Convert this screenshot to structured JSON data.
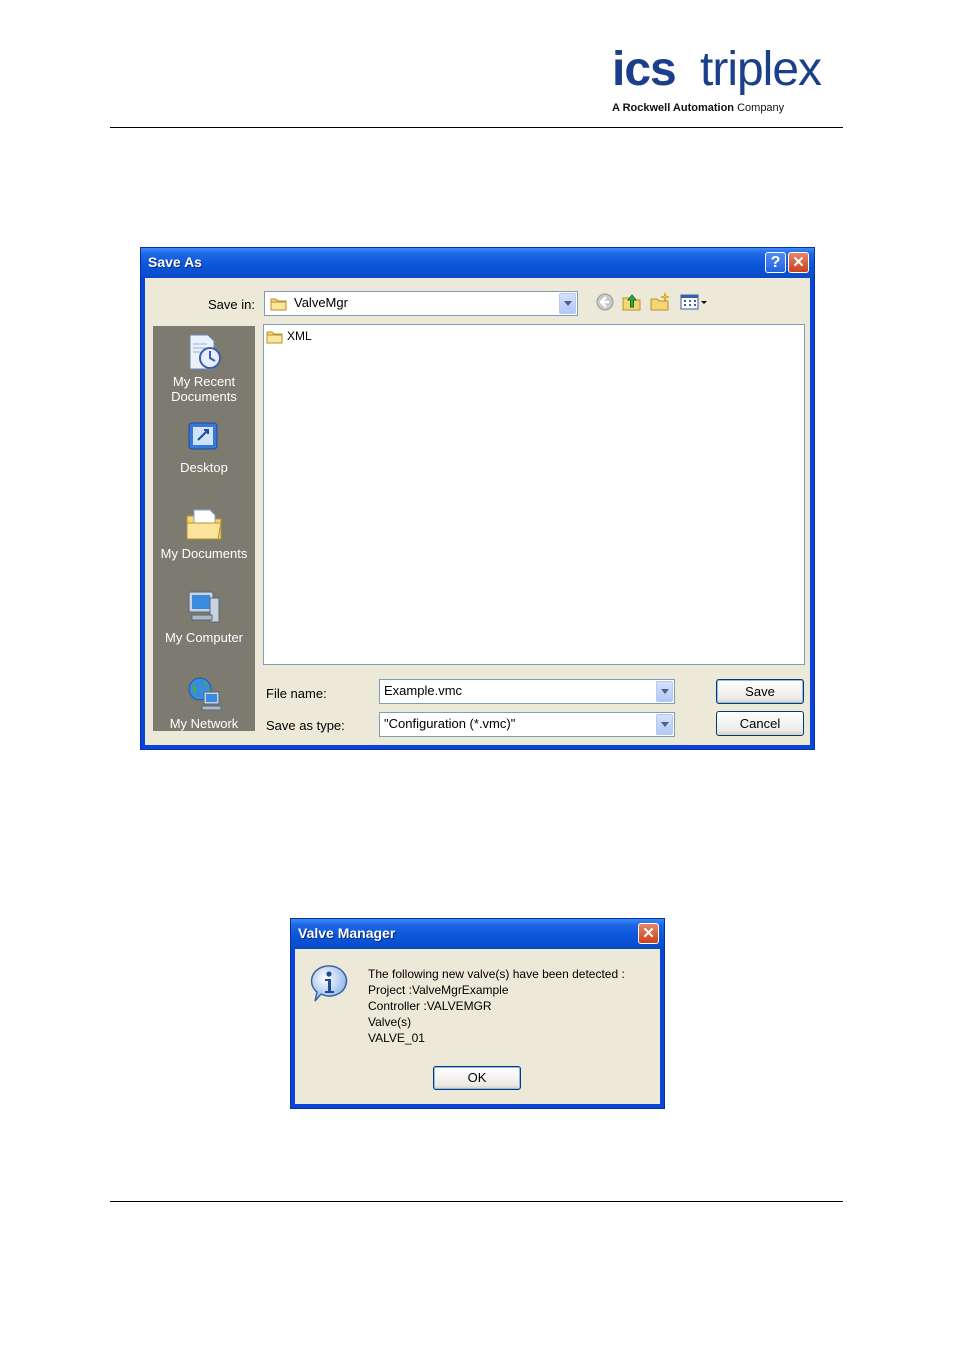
{
  "header": {
    "logo_ics": "ics",
    "logo_triplex": "triplex",
    "logo_tagline_bold": "A Rockwell Automation",
    "logo_tagline_rest": "Company",
    "brand_color": "#1b3f8b"
  },
  "save_as": {
    "title": "Save As",
    "help_glyph": "?",
    "close_glyph": "✕",
    "save_in_label": "Save in:",
    "save_in_value": "ValveMgr",
    "toolbar_icons": [
      "back-icon",
      "up-folder-icon",
      "new-folder-icon",
      "views-menu-icon"
    ],
    "places": [
      {
        "label": "My Recent Documents",
        "icon": "recent-documents-icon"
      },
      {
        "label": "Desktop",
        "icon": "desktop-icon"
      },
      {
        "label": "My Documents",
        "icon": "my-documents-icon"
      },
      {
        "label": "My Computer",
        "icon": "my-computer-icon"
      },
      {
        "label": "My Network",
        "icon": "my-network-icon"
      }
    ],
    "files": [
      {
        "name": "XML",
        "type": "folder"
      }
    ],
    "file_name_label": "File name:",
    "file_name_value": "Example.vmc",
    "save_type_label": "Save as type:",
    "save_type_value": "\"Configuration (*.vmc)\"",
    "save_button": "Save",
    "cancel_button": "Cancel"
  },
  "valve_manager": {
    "title": "Valve Manager",
    "close_glyph": "✕",
    "icon": "information-icon",
    "lines": [
      "The following new valve(s) have been detected :",
      "Project :ValveMgrExample",
      "Controller :VALVEMGR",
      "Valve(s)",
      "VALVE_01"
    ],
    "ok_button": "OK"
  }
}
